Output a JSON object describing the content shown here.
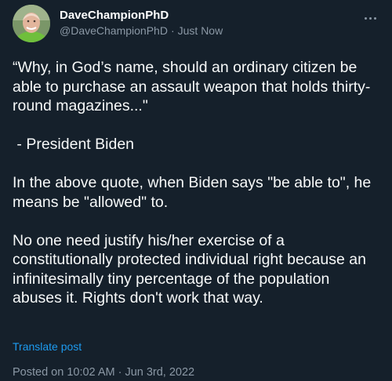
{
  "author": {
    "display_name": "DaveChampionPhD",
    "handle": "@DaveChampionPhD",
    "separator": "·",
    "time": "Just Now"
  },
  "more_icon": "more-horizontal-icon",
  "tweet": {
    "paragraphs": [
      "“Why, in God’s name, should an ordinary citizen be able to purchase an assault weapon that holds thirty-round magazines...\"",
      " - President Biden",
      "In the above quote, when Biden says \"be able to\", he means be \"allowed\" to.",
      "No one need justify his/her exercise of a constitutionally protected individual right because an infinitesimally tiny percentage of the population abuses it. Rights don't work that way."
    ]
  },
  "translate_label": "Translate post",
  "posted": {
    "prefix": "Posted on 10:02 AM",
    "separator": "·",
    "date": "Jun 3rd, 2022"
  },
  "colors": {
    "background": "#15202b",
    "text": "#f7f9f9",
    "muted": "#8b98a5",
    "link": "#1d9bf0"
  }
}
